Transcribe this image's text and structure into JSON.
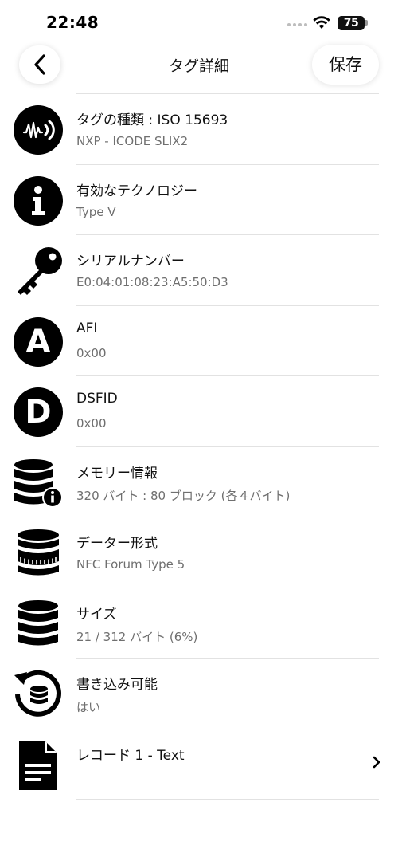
{
  "status_bar": {
    "time": "22:48",
    "battery": "75"
  },
  "nav": {
    "title": "タグ詳細",
    "save_label": "保存"
  },
  "rows": [
    {
      "icon": "nfc-signal-icon",
      "title": "タグの種類 : ISO 15693",
      "subtitle": "NXP - ICODE SLIX2"
    },
    {
      "icon": "info-icon",
      "title": "有効なテクノロジー",
      "subtitle": "Type V"
    },
    {
      "icon": "key-icon",
      "title": "シリアルナンバー",
      "subtitle": "E0:04:01:08:23:A5:50:D3"
    },
    {
      "icon": "letter-a-icon",
      "letter": "A",
      "title": "AFI",
      "subtitle": "0x00"
    },
    {
      "icon": "letter-d-icon",
      "letter": "D",
      "title": "DSFID",
      "subtitle": "0x00"
    },
    {
      "icon": "database-info-icon",
      "title": "メモリー情報",
      "subtitle": "320 バイト : 80 ブロック (各４バイト)"
    },
    {
      "icon": "coins-stack-icon",
      "title": "データー形式",
      "subtitle": "NFC Forum Type 5"
    },
    {
      "icon": "database-icon",
      "title": "サイズ",
      "subtitle": "21 / 312 バイト (6%)"
    },
    {
      "icon": "database-history-icon",
      "title": "書き込み可能",
      "subtitle": "はい"
    },
    {
      "icon": "document-icon",
      "title": "レコード 1 - Text"
    }
  ]
}
